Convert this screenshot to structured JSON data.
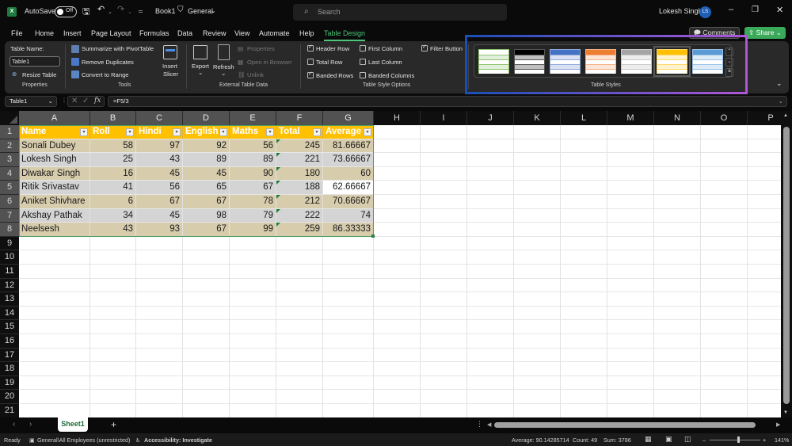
{
  "titlebar": {
    "autosave_label": "AutoSave",
    "autosave_state": "Off",
    "doc_name": "Book1",
    "sensitivity": "General",
    "search_placeholder": "Search",
    "user_name": "Lokesh Singh",
    "user_initials": "LS"
  },
  "menu": {
    "tabs": [
      "File",
      "Home",
      "Insert",
      "Page Layout",
      "Formulas",
      "Data",
      "Review",
      "View",
      "Automate",
      "Help",
      "Table Design"
    ],
    "active_tab": "Table Design",
    "comments_label": "Comments",
    "share_label": "Share"
  },
  "ribbon": {
    "properties": {
      "table_name_label": "Table Name:",
      "table_name_value": "Table1",
      "resize_label": "Resize Table",
      "group_label": "Properties"
    },
    "tools": {
      "summarize_label": "Summarize with PivotTable",
      "remove_dup_label": "Remove Duplicates",
      "convert_label": "Convert to Range",
      "insert_slicer_line1": "Insert",
      "insert_slicer_line2": "Slicer",
      "group_label": "Tools"
    },
    "external": {
      "export_label": "Export",
      "refresh_label": "Refresh",
      "properties_label": "Properties",
      "open_browser_label": "Open in Browser",
      "unlink_label": "Unlink",
      "group_label": "External Table Data"
    },
    "style_options": {
      "header_row": {
        "label": "Header Row",
        "checked": true
      },
      "total_row": {
        "label": "Total Row",
        "checked": false
      },
      "banded_rows": {
        "label": "Banded Rows",
        "checked": true
      },
      "first_column": {
        "label": "First Column",
        "checked": false
      },
      "last_column": {
        "label": "Last Column",
        "checked": false
      },
      "banded_columns": {
        "label": "Banded Columns",
        "checked": false
      },
      "filter_button": {
        "label": "Filter Button",
        "checked": true
      },
      "group_label": "Table Style Options"
    },
    "table_styles": {
      "group_label": "Table Styles",
      "swatches": [
        {
          "name": "Green Light",
          "header": "#ffffff",
          "band": "#e2efda",
          "line": "#8fc36f"
        },
        {
          "name": "Black Dark",
          "header": "#000000",
          "band": "#bfbfbf",
          "line": "#555555"
        },
        {
          "name": "Blue Medium",
          "header": "#4472c4",
          "band": "#d9e1f2",
          "line": "#8ea9db"
        },
        {
          "name": "Orange Medium",
          "header": "#ed7d31",
          "band": "#fce4d6",
          "line": "#f4b084"
        },
        {
          "name": "Gray Medium",
          "header": "#a5a5a5",
          "band": "#ededed",
          "line": "#c9c9c9"
        },
        {
          "name": "Gold Medium",
          "header": "#ffc000",
          "band": "#fff2cc",
          "line": "#ffd966"
        },
        {
          "name": "Blue Medium 2",
          "header": "#5b9bd5",
          "band": "#ddebf7",
          "line": "#9bc2e6"
        }
      ],
      "selected_index": 5
    }
  },
  "formula_bar": {
    "name_box": "Table1",
    "formula": "=F5/3"
  },
  "grid": {
    "columns": [
      "A",
      "B",
      "C",
      "D",
      "E",
      "F",
      "G",
      "H",
      "I",
      "J",
      "K",
      "L",
      "M",
      "N",
      "O",
      "P"
    ],
    "rows": [
      "1",
      "2",
      "3",
      "4",
      "5",
      "6",
      "7",
      "8",
      "9",
      "10",
      "11",
      "12",
      "13",
      "14",
      "15",
      "16",
      "17",
      "18",
      "19",
      "20",
      "21"
    ],
    "table": {
      "headers": [
        "Name",
        "Roll",
        "Hindi",
        "English",
        "Maths",
        "Total",
        "Average"
      ],
      "rows": [
        [
          "Sonali Dubey",
          "58",
          "97",
          "92",
          "56",
          "245",
          "81.66667"
        ],
        [
          "Lokesh Singh",
          "25",
          "43",
          "89",
          "89",
          "221",
          "73.66667"
        ],
        [
          "Diwakar Singh",
          "16",
          "45",
          "45",
          "90",
          "180",
          "60"
        ],
        [
          "Ritik Srivastav",
          "41",
          "56",
          "65",
          "67",
          "188",
          "62.66667"
        ],
        [
          "Aniket Shivhare",
          "6",
          "67",
          "67",
          "78",
          "212",
          "70.66667"
        ],
        [
          "Akshay Pathak",
          "34",
          "45",
          "98",
          "79",
          "222",
          "74"
        ],
        [
          "Neelsesh",
          "43",
          "93",
          "67",
          "99",
          "259",
          "86.33333"
        ]
      ],
      "active_cell": "G5",
      "colors": {
        "header": "#ffc000",
        "band_a": "#d7ccac",
        "band_b": "#d4d4d4"
      }
    }
  },
  "sheet_tabs": {
    "tabs": [
      "Sheet1"
    ],
    "active": "Sheet1"
  },
  "status": {
    "ready": "Ready",
    "sensitivity": "General\\All Employees (unrestricted)",
    "accessibility": "Accessibility: Investigate",
    "average": "Average: 90.14285714",
    "count": "Count: 49",
    "sum": "Sum: 3786",
    "zoom": "141%"
  }
}
